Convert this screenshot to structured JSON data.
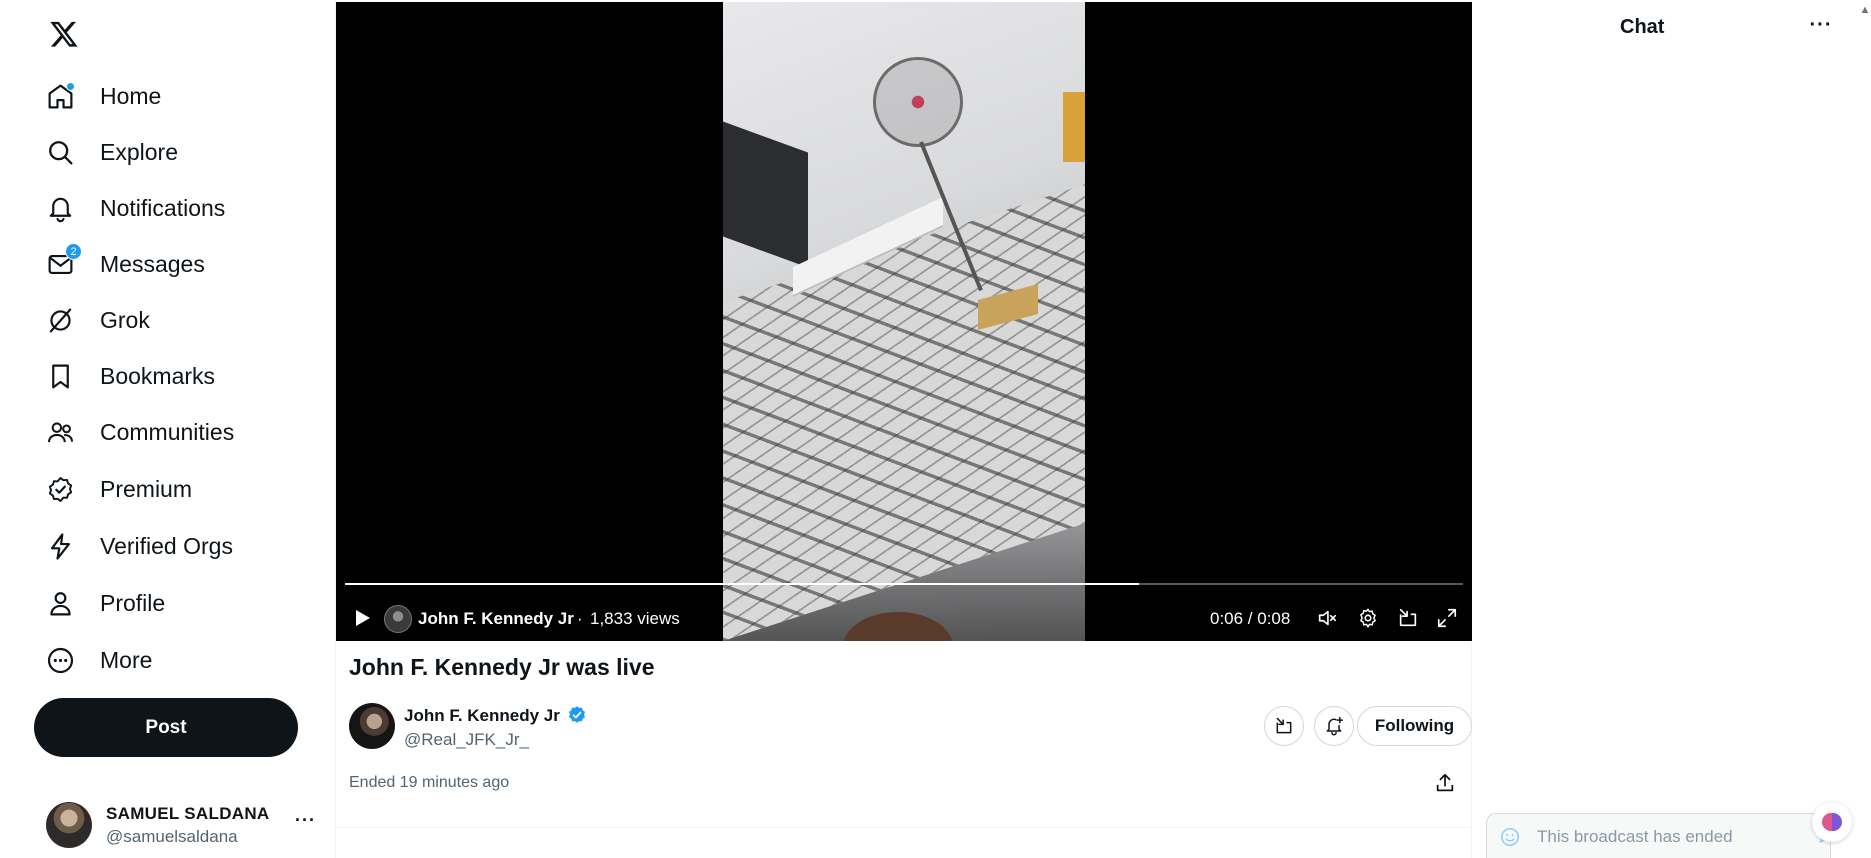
{
  "sidebar": {
    "logo_icon": "x-logo-icon",
    "items": [
      {
        "label": "Home",
        "icon": "home-icon"
      },
      {
        "label": "Explore",
        "icon": "search-icon"
      },
      {
        "label": "Notifications",
        "icon": "bell-icon"
      },
      {
        "label": "Messages",
        "icon": "mail-icon",
        "badge": "2"
      },
      {
        "label": "Grok",
        "icon": "grok-icon"
      },
      {
        "label": "Bookmarks",
        "icon": "bookmark-icon"
      },
      {
        "label": "Communities",
        "icon": "people-icon"
      },
      {
        "label": "Premium",
        "icon": "verified-badge-icon"
      },
      {
        "label": "Verified Orgs",
        "icon": "lightning-icon"
      },
      {
        "label": "Profile",
        "icon": "person-icon"
      },
      {
        "label": "More",
        "icon": "more-circle-icon"
      }
    ],
    "post_label": "Post",
    "account": {
      "name": "SAMUEL SALDANA",
      "handle": "@samuelsaldana"
    }
  },
  "player": {
    "broadcaster": "John F. Kennedy Jr",
    "separator": "·",
    "views": "1,833 views",
    "time": "0:06 / 0:08",
    "progress": 0.71
  },
  "broadcast": {
    "title": "John F. Kennedy Jr was live",
    "host_name": "John F. Kennedy Jr",
    "host_handle": "@Real_JFK_Jr_",
    "following_label": "Following",
    "ended": "Ended 19 minutes ago"
  },
  "chat": {
    "title": "Chat",
    "more": "···",
    "placeholder": "This broadcast has ended"
  },
  "colors": {
    "accent": "#1d9bf0",
    "text": "#0f1419",
    "secondary": "#536471",
    "border": "#cfd9de"
  }
}
